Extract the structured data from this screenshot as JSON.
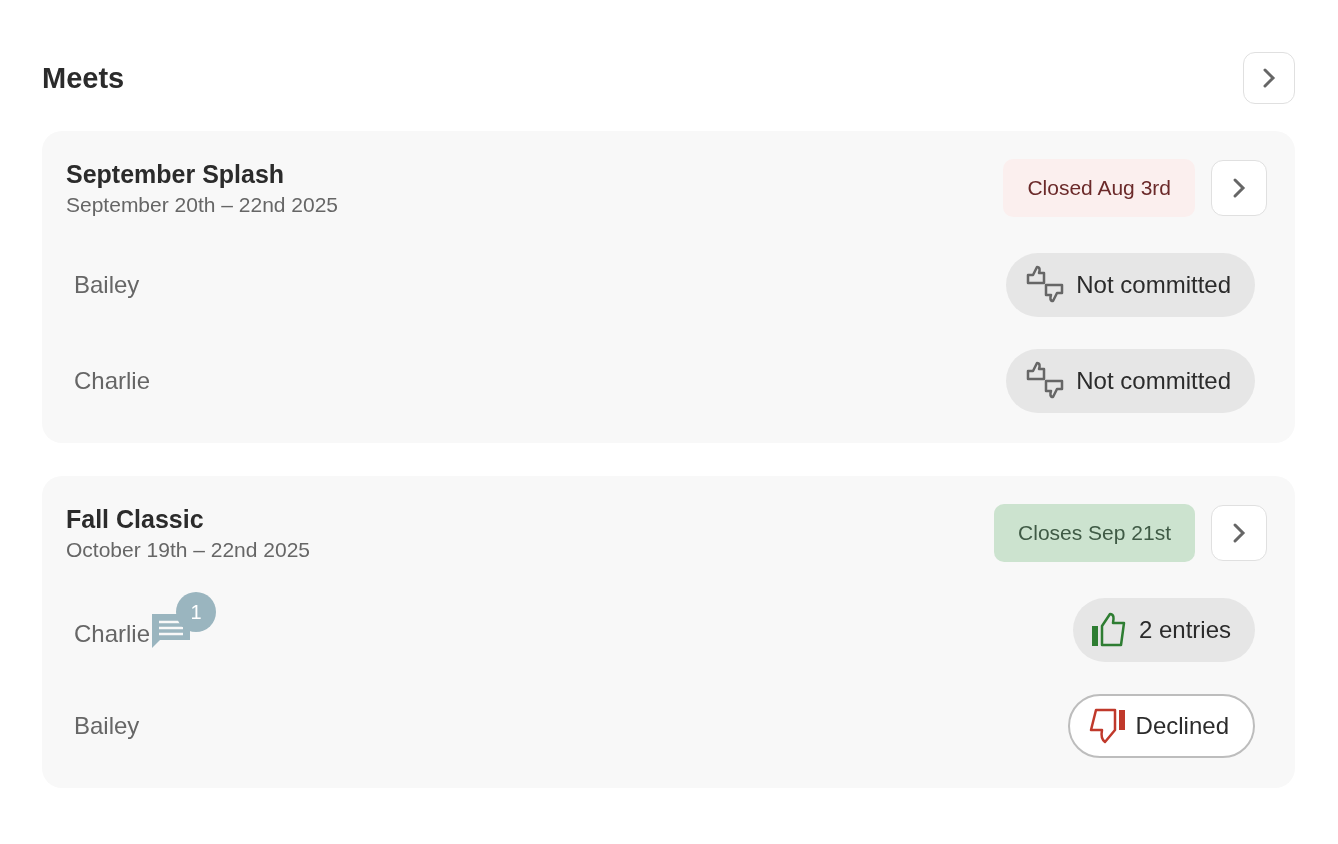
{
  "title": "Meets",
  "meets": [
    {
      "name": "September Splash",
      "dates": "September 20th – 22nd 2025",
      "deadline": {
        "label": "Closed Aug 3rd",
        "kind": "closed"
      },
      "swimmers": [
        {
          "name": "Bailey",
          "status": {
            "kind": "uncommitted",
            "label": "Not committed"
          }
        },
        {
          "name": "Charlie",
          "status": {
            "kind": "uncommitted",
            "label": "Not committed"
          }
        }
      ]
    },
    {
      "name": "Fall Classic",
      "dates": "October 19th – 22nd 2025",
      "deadline": {
        "label": "Closes Sep 21st",
        "kind": "open"
      },
      "swimmers": [
        {
          "name": "Charlie",
          "comments": "1",
          "status": {
            "kind": "entered",
            "label": "2 entries"
          }
        },
        {
          "name": "Bailey",
          "status": {
            "kind": "declined",
            "label": "Declined"
          }
        }
      ]
    }
  ]
}
